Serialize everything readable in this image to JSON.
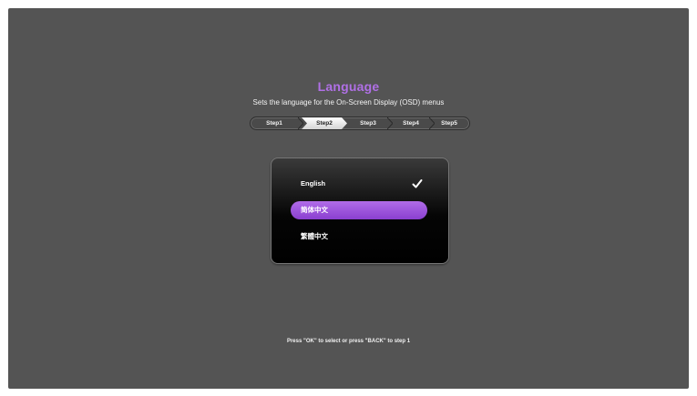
{
  "osd": {
    "title": "Language",
    "subtitle": "Sets the language for the On-Screen Display (OSD) menus",
    "title_color": "#b070e6",
    "background_color": "#545454",
    "highlight_color": "#9b55dc"
  },
  "steps": {
    "items": [
      "Step1",
      "Step2",
      "Step3",
      "Step4",
      "Step5"
    ],
    "current": "Step2"
  },
  "languages": {
    "items": [
      {
        "label": "English",
        "checked": true,
        "highlighted": false
      },
      {
        "label": "简体中文",
        "checked": false,
        "highlighted": true
      },
      {
        "label": "繁體中文",
        "checked": false,
        "highlighted": false
      }
    ],
    "check_icon": "checkmark-icon"
  },
  "footer": {
    "hint": "Press \"OK\" to select or press \"BACK\" to step 1"
  }
}
